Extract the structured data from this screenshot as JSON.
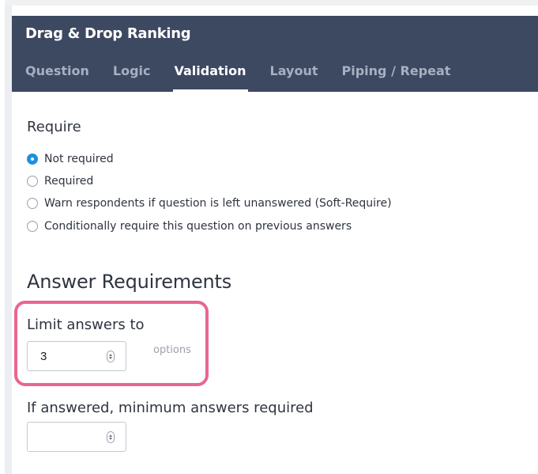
{
  "header": {
    "title": "Drag & Drop Ranking",
    "tabs": [
      {
        "label": "Question",
        "active": false
      },
      {
        "label": "Logic",
        "active": false
      },
      {
        "label": "Validation",
        "active": true
      },
      {
        "label": "Layout",
        "active": false
      },
      {
        "label": "Piping / Repeat",
        "active": false
      }
    ]
  },
  "require": {
    "heading": "Require",
    "options": [
      {
        "label": "Not required",
        "selected": true
      },
      {
        "label": "Required",
        "selected": false
      },
      {
        "label": "Warn respondents if question is left unanswered (Soft-Require)",
        "selected": false
      },
      {
        "label": "Conditionally require this question on previous answers",
        "selected": false
      }
    ]
  },
  "answer_requirements": {
    "heading": "Answer Requirements",
    "limit": {
      "label": "Limit answers to",
      "value": "3",
      "suffix": "options"
    },
    "minimum": {
      "label": "If answered, minimum answers required",
      "value": ""
    }
  },
  "colors": {
    "header_bg": "#3d4861",
    "tab_inactive": "#a7b0c2",
    "tab_active": "#ffffff",
    "radio_selected": "#1f8fe0",
    "highlight": "#e8678e"
  }
}
